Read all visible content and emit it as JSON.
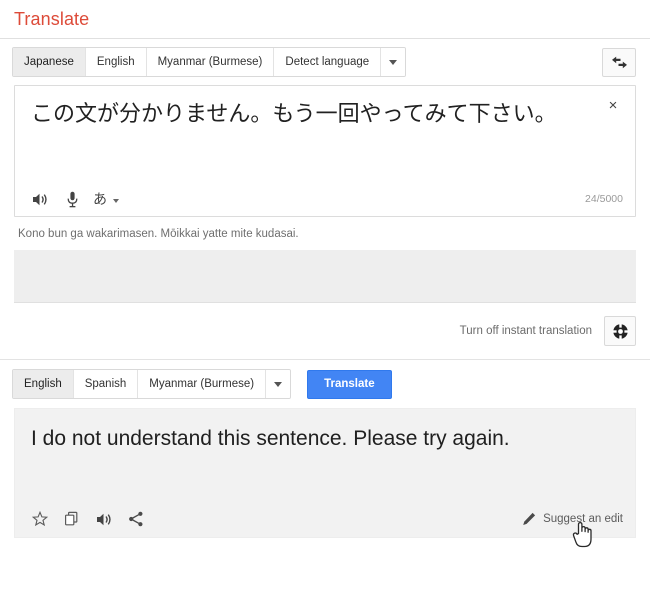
{
  "header": {
    "title": "Translate"
  },
  "source": {
    "tabs": [
      {
        "label": "Japanese",
        "active": true
      },
      {
        "label": "English",
        "active": false
      },
      {
        "label": "Myanmar (Burmese)",
        "active": false
      },
      {
        "label": "Detect language",
        "active": false
      }
    ],
    "dropdown_icon": "chevron-down-icon",
    "swap_icon": "swap-languages-icon",
    "text": "この文が分かりません。もう一回やってみて下さい。",
    "clear_label": "×",
    "listen_icon": "speaker-icon",
    "mic_icon": "microphone-icon",
    "ime_label": "あ",
    "char_count": "24/5000",
    "romanization": "Kono bun ga wakarimasen. Mōikkai yatte mite kudasai."
  },
  "instant": {
    "label": "Turn off instant translation",
    "gear_icon": "gear-icon"
  },
  "target": {
    "tabs": [
      {
        "label": "English",
        "active": true
      },
      {
        "label": "Spanish",
        "active": false
      },
      {
        "label": "Myanmar (Burmese)",
        "active": false
      }
    ],
    "dropdown_icon": "chevron-down-icon",
    "translate_button": "Translate",
    "text": "I do not understand this sentence. Please try again.",
    "star_icon": "star-icon",
    "copy_icon": "copy-icon",
    "listen_icon": "speaker-icon",
    "share_icon": "share-icon",
    "suggest_edit": "Suggest an edit",
    "pencil_icon": "pencil-icon",
    "cursor_icon": "hand-cursor-icon"
  },
  "colors": {
    "title_red": "#dd4b39",
    "button_blue": "#4285f4",
    "output_background": "#f2f2f2",
    "active_tab": "#ececec"
  }
}
